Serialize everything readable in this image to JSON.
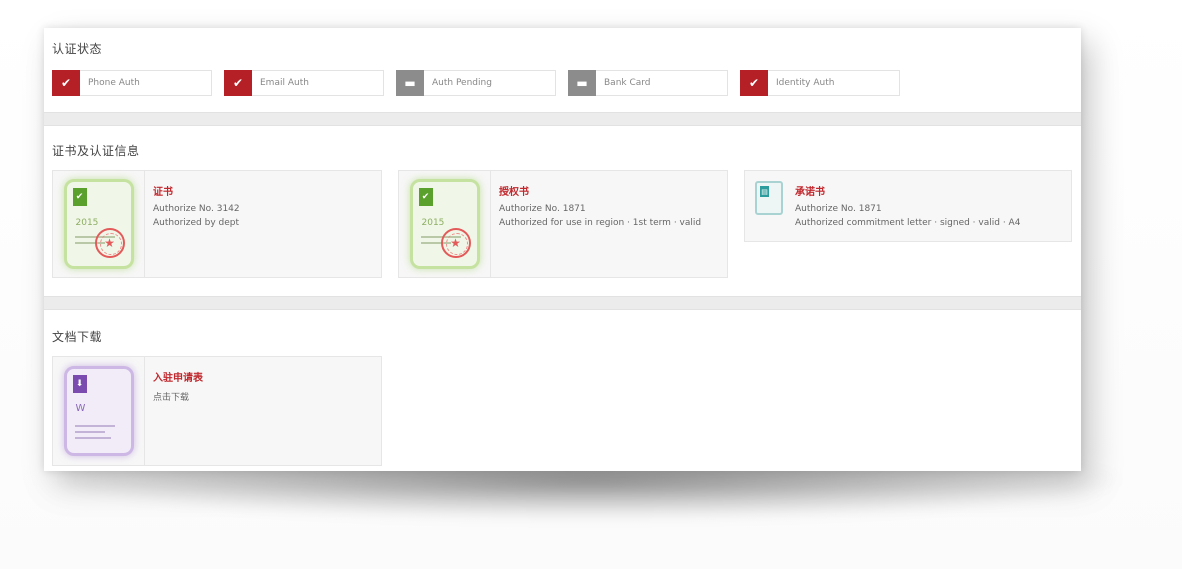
{
  "sections": {
    "status": {
      "title": "认证状态",
      "items": [
        {
          "label": "Phone Auth",
          "state": "done",
          "badge_icon": "check-icon"
        },
        {
          "label": "Email Auth",
          "state": "done",
          "badge_icon": "check-icon"
        },
        {
          "label": "Auth Pending",
          "state": "todo",
          "badge_icon": "minus-icon"
        },
        {
          "label": "Bank Card",
          "state": "todo",
          "badge_icon": "minus-icon"
        },
        {
          "label": "Identity Auth",
          "state": "done",
          "badge_icon": "check-icon"
        }
      ]
    },
    "certificates": {
      "title": "证书及认证信息",
      "cards": [
        {
          "title": "证书",
          "lines": [
            "Authorize No. 3142",
            "Authorized by dept"
          ],
          "doc_code": "2015",
          "thumb": "green"
        },
        {
          "title": "授权书",
          "lines": [
            "Authorize No. 1871",
            "Authorized for use in region · 1st term · valid"
          ],
          "doc_code": "2015",
          "thumb": "green"
        },
        {
          "title": "承诺书",
          "lines": [
            "Authorize No. 1871",
            "Authorized commitment letter · signed · valid · A4"
          ],
          "doc_code": "",
          "thumb": "teal"
        }
      ]
    },
    "downloads": {
      "title": "文档下载",
      "cards": [
        {
          "title": "入驻申请表",
          "lines": [
            "点击下载"
          ],
          "doc_code": "W",
          "thumb": "purple"
        }
      ]
    }
  },
  "colors": {
    "accent_red": "#b42025",
    "pending_gray": "#8c8c8c",
    "green_doc": "#c6e2a1",
    "purple_doc": "#cdb8e5",
    "teal_doc": "#a9d2d2"
  }
}
